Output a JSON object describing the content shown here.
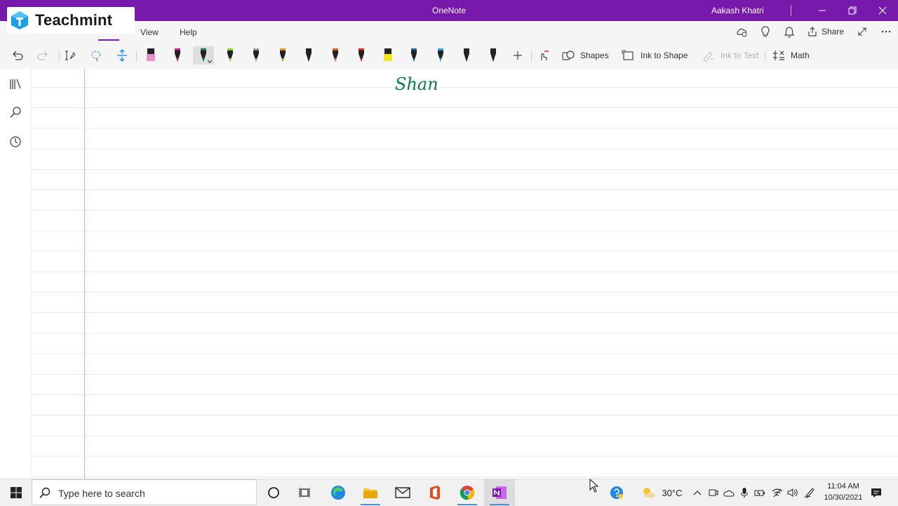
{
  "window": {
    "title": "OneNote",
    "user": "Aakash Khatri"
  },
  "logo": {
    "text": "Teachmint"
  },
  "menu": {
    "items": [
      "View",
      "Help"
    ]
  },
  "toolbar": {
    "shapes_label": "Shapes",
    "ink_to_shape_label": "Ink to Shape",
    "ink_to_text_label": "Ink to Text",
    "math_label": "Math",
    "share_label": "Share",
    "pen_colors": [
      "#e891c8",
      "#e0127e",
      "#0f7b45",
      "#7fd32a",
      "#9a9a9a",
      "#f08a1c",
      "#222222",
      "#f05a22",
      "#e81b1b",
      "#f7e51b",
      "#1a5fb4",
      "#29a7e1",
      "#222222",
      "#222222"
    ]
  },
  "page": {
    "ink_text": "Shan"
  },
  "taskbar": {
    "search_placeholder": "Type here to search",
    "weather": "30°C",
    "time": "11:04 AM",
    "date": "10/30/2021"
  },
  "colors": {
    "accent": "#7719aa",
    "ink": "#0c7a4a",
    "margin": "#f0a6aa"
  }
}
